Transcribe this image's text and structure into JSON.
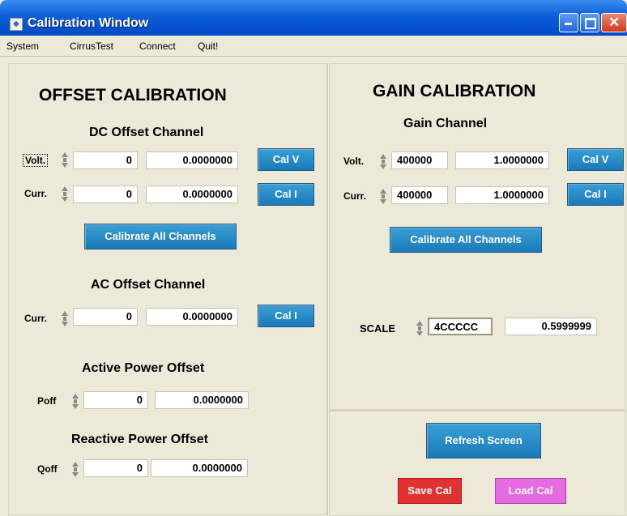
{
  "window": {
    "title": "Calibration Window"
  },
  "menu": [
    "System",
    "CirrusTest",
    "Connect",
    "Quit!"
  ],
  "offset": {
    "title": "OFFSET CALIBRATION",
    "dc_heading": "DC Offset Channel",
    "volt": {
      "label": "Volt.",
      "hex": "0",
      "value": "0.0000000",
      "button": "Cal V"
    },
    "curr": {
      "label": "Curr.",
      "hex": "0",
      "value": "0.0000000",
      "button": "Cal I"
    },
    "calibrate_all": "Calibrate All Channels",
    "ac_heading": "AC Offset Channel",
    "ac_curr": {
      "label": "Curr.",
      "hex": "0",
      "value": "0.0000000",
      "button": "Cal I"
    },
    "active_heading": "Active Power Offset",
    "poff": {
      "label": "Poff",
      "hex": "0",
      "value": "0.0000000"
    },
    "reactive_heading": "Reactive Power Offset",
    "qoff": {
      "label": "Qoff",
      "hex": "0",
      "value": "0.0000000"
    }
  },
  "gain": {
    "title": "GAIN CALIBRATION",
    "channel_heading": "Gain Channel",
    "volt": {
      "label": "Volt.",
      "hex": "400000",
      "value": "1.0000000",
      "button": "Cal V"
    },
    "curr": {
      "label": "Curr.",
      "hex": "400000",
      "value": "1.0000000",
      "button": "Cal I"
    },
    "calibrate_all": "Calibrate All Channels",
    "scale": {
      "label": "SCALE",
      "hex": "4CCCCC",
      "value": "0.5999999"
    }
  },
  "actions": {
    "refresh": "Refresh Screen",
    "save": "Save Cal",
    "load": "Load Cal"
  }
}
